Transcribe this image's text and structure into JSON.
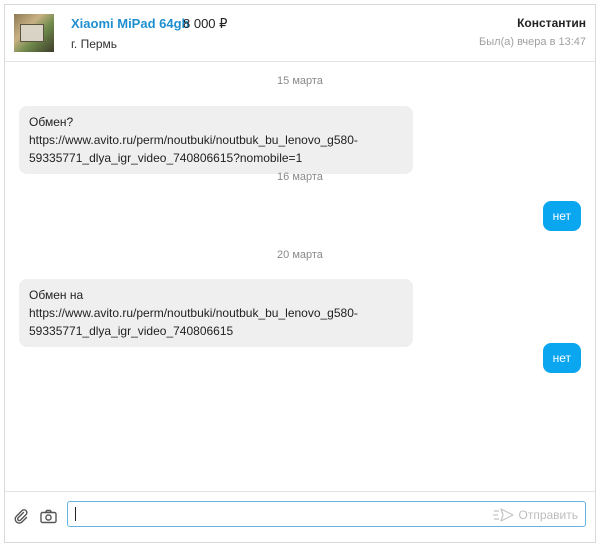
{
  "header": {
    "item_title": "Xiaomi MiPad 64gb",
    "item_price": "8 000 ₽",
    "location": "г. Пермь",
    "user_name": "Константин",
    "last_seen": "Был(а) вчера в 13:47"
  },
  "messages": {
    "date_1": "15 марта",
    "msg_1_line_1": "Обмен? https://www.avito.ru/perm/noutbuki/noutbuk_bu_lenovo_g580-",
    "msg_1_line_2": "59335771_dlya_igr_video_740806615?nomobile=1",
    "date_2": "16 марта",
    "msg_2": "нет",
    "date_3": "20 марта",
    "msg_3_line_1": "Обмен на https://www.avito.ru/perm/noutbuki/noutbuk_bu_lenovo_g580-",
    "msg_3_line_2": "59335771_dlya_igr_video_740806615",
    "msg_4": "нет"
  },
  "composer": {
    "input_value": "",
    "send_label": "Отправить",
    "attach_icon": "paperclip-icon",
    "camera_icon": "camera-icon"
  },
  "colors": {
    "accent": "#0aa6f0",
    "link": "#1f8fcf",
    "incoming_bubble": "#efefef",
    "muted": "#a0a0a0"
  }
}
